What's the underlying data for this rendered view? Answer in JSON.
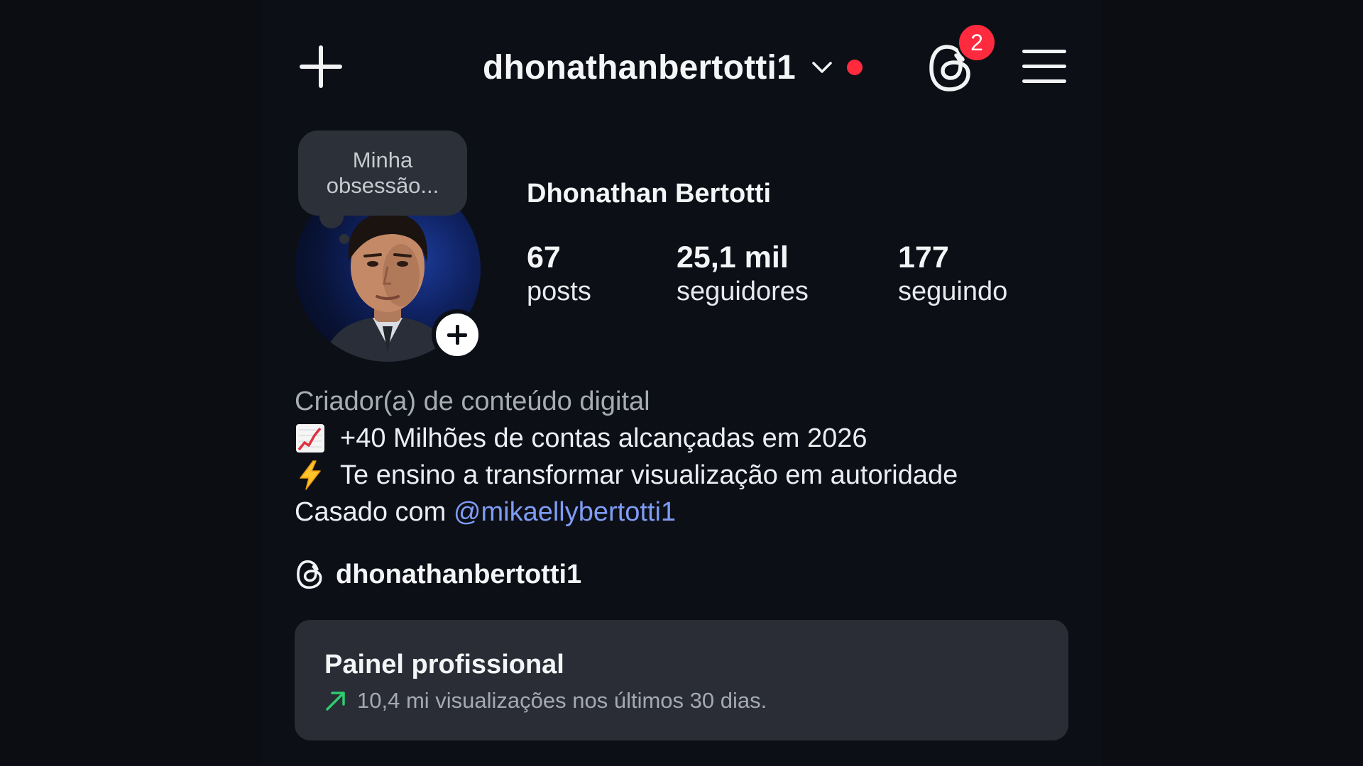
{
  "header": {
    "username": "dhonathanbertotti1",
    "notification_count": "2",
    "icons": [
      "plus-icon",
      "chevron-down-icon",
      "live-indicator",
      "threads-icon",
      "hamburger-menu-icon"
    ],
    "accent_red": "#ff2a3d"
  },
  "profile": {
    "note": "Minha obsessão...",
    "full_name": "Dhonathan Bertotti",
    "stats": {
      "posts": {
        "value": "67",
        "label": "posts"
      },
      "followers": {
        "value": "25,1 mil",
        "label": "seguidores"
      },
      "following": {
        "value": "177",
        "label": "seguindo"
      }
    }
  },
  "bio": {
    "category": "Criador(a) de conteúdo digital",
    "line1": "+40 Milhões de contas alcançadas em 2026",
    "line1_icon": "chart-increasing-emoji",
    "line2": "Te ensino a transformar visualização em autoridade",
    "line2_icon": "lightning-emoji",
    "line3_prefix": "Casado com ",
    "mention": "@mikaellybertotti1",
    "mention_color": "#7f9cf5"
  },
  "threads_link": {
    "handle": "dhonathanbertotti1"
  },
  "dashboard": {
    "title": "Painel profissional",
    "subtitle": "10,4 mi visualizações nos últimos 30 dias.",
    "trend_color": "#2ecc71"
  }
}
